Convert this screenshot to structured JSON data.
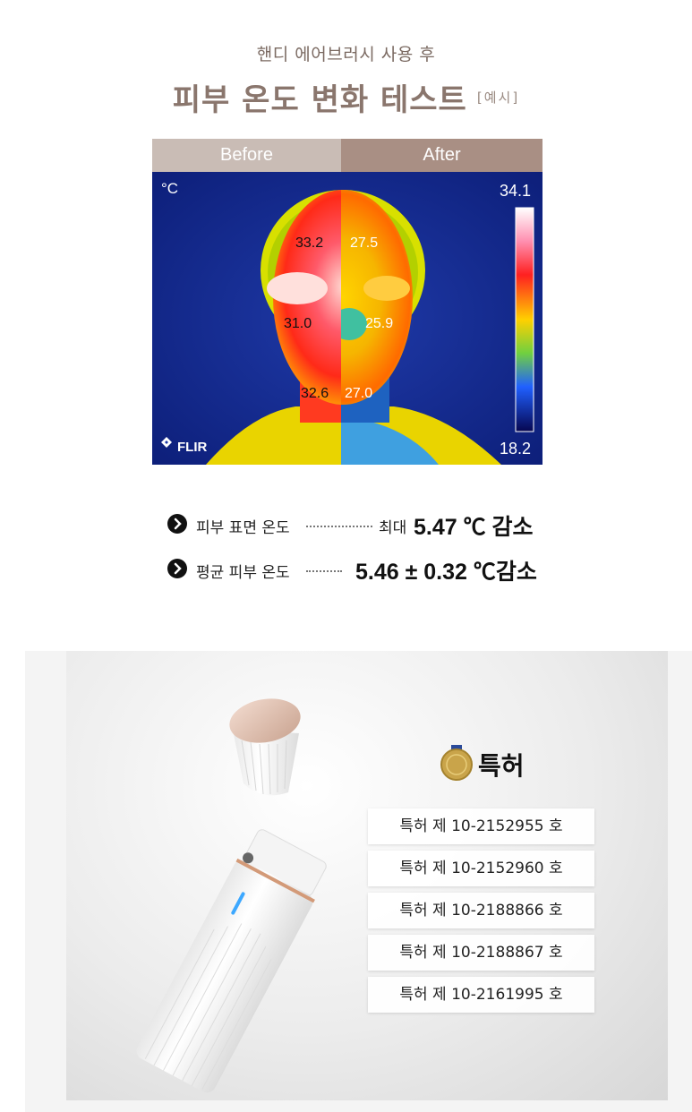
{
  "header": {
    "subtitle": "핸디 에어브러시 사용 후",
    "title": "피부 온도 변화 테스트",
    "example_tag": "[예시]"
  },
  "thermal": {
    "before_label": "Before",
    "after_label": "After",
    "unit": "°C",
    "scale_max": "34.1",
    "scale_min": "18.2",
    "brand": "FLIR",
    "before_readings": [
      "33.2",
      "31.0",
      "32.6"
    ],
    "after_readings": [
      "27.5",
      "25.9",
      "27.0"
    ]
  },
  "stats": [
    {
      "label": "피부 표면 온도",
      "prefix": "최대",
      "value": "5.47 ℃ 감소"
    },
    {
      "label": "평균 피부 온도",
      "prefix": "",
      "value": "5.46 ± 0.32 ℃감소"
    }
  ],
  "patent": {
    "title": "특허",
    "items": [
      "특허 제 10-2152955 호",
      "특허 제 10-2152960 호",
      "특허 제 10-2188866 호",
      "특허 제 10-2188867 호",
      "특허 제 10-2161995 호"
    ]
  },
  "colors": {
    "title": "#8a766d",
    "before_header": "#c9bcb5",
    "after_header": "#a98f84"
  }
}
